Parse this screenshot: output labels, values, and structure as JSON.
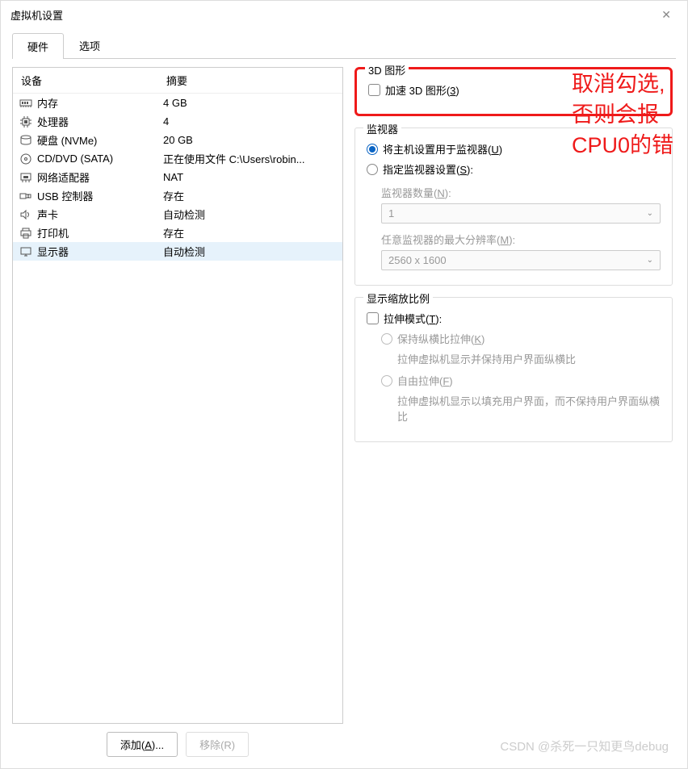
{
  "window": {
    "title": "虚拟机设置"
  },
  "tabs": {
    "hardware": "硬件",
    "options": "选项"
  },
  "hw_header": {
    "device": "设备",
    "summary": "摘要"
  },
  "hw_items": [
    {
      "name": "内存",
      "summary": "4 GB",
      "icon": "memory"
    },
    {
      "name": "处理器",
      "summary": "4",
      "icon": "cpu"
    },
    {
      "name": "硬盘 (NVMe)",
      "summary": "20 GB",
      "icon": "disk"
    },
    {
      "name": "CD/DVD (SATA)",
      "summary": "正在使用文件 C:\\Users\\robin...",
      "icon": "cd"
    },
    {
      "name": "网络适配器",
      "summary": "NAT",
      "icon": "net"
    },
    {
      "name": "USB 控制器",
      "summary": "存在",
      "icon": "usb"
    },
    {
      "name": "声卡",
      "summary": "自动检测",
      "icon": "sound"
    },
    {
      "name": "打印机",
      "summary": "存在",
      "icon": "printer"
    },
    {
      "name": "显示器",
      "summary": "自动检测",
      "icon": "display"
    }
  ],
  "buttons": {
    "add": "添加(A)...",
    "remove": "移除(R)"
  },
  "group_3d": {
    "title": "3D 图形",
    "accel_label": "加速 3D 图形(",
    "accel_key": "3",
    "accel_after": ")"
  },
  "group_monitor": {
    "title": "监视器",
    "use_host": "将主机设置用于监视器(",
    "use_host_key": "U",
    "use_host_after": ")",
    "specify": "指定监视器设置(",
    "specify_key": "S",
    "specify_after": "):",
    "count_label": "监视器数量(",
    "count_key": "N",
    "count_after": "):",
    "count_value": "1",
    "maxres_label": "任意监视器的最大分辨率(",
    "maxres_key": "M",
    "maxres_after": "):",
    "maxres_value": "2560 x 1600"
  },
  "group_scale": {
    "title": "显示缩放比例",
    "stretch": "拉伸模式(",
    "stretch_key": "T",
    "stretch_after": "):",
    "keep_ratio": "保持纵横比拉伸(",
    "keep_key": "K",
    "keep_after": ")",
    "keep_desc": "拉伸虚拟机显示并保持用户界面纵横比",
    "free": "自由拉伸(",
    "free_key": "F",
    "free_after": ")",
    "free_desc": "拉伸虚拟机显示以填充用户界面，而不保持用户界面纵横比"
  },
  "annotation": {
    "line1": "取消勾选,",
    "line2": "否则会报",
    "line3": "CPU0的错"
  },
  "watermark": "CSDN @杀死一只知更鸟debug"
}
